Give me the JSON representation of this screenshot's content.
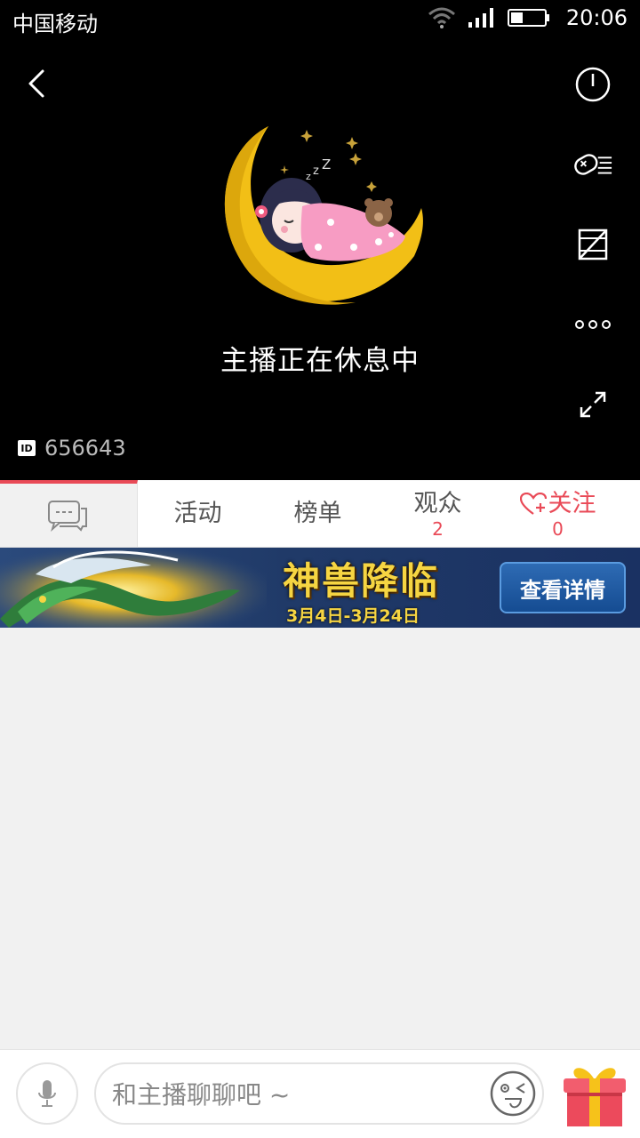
{
  "status_bar": {
    "carrier": "中国移动",
    "time": "20:06",
    "icons": [
      "wifi-icon",
      "signal-icon",
      "battery-icon"
    ]
  },
  "player": {
    "resting_text": "主播正在休息中",
    "room_id": "656643",
    "id_badge": "ID",
    "icons": [
      "back-icon",
      "power-icon",
      "gamepad-icon",
      "danmaku-off-icon",
      "more-icon",
      "fullscreen-icon"
    ]
  },
  "tabs": [
    {
      "label": "",
      "icon": "chat-bubble-icon"
    },
    {
      "label": "活动"
    },
    {
      "label": "榜单"
    },
    {
      "label": "观众",
      "count": "2"
    },
    {
      "label": "关注",
      "count": "0",
      "icon": "heart-plus-icon"
    }
  ],
  "banner": {
    "title": "神兽降临",
    "dates": "3月4日-3月24日",
    "button": "查看详情"
  },
  "bottom_bar": {
    "placeholder": "和主播聊聊吧 ~",
    "icons": [
      "mic-icon",
      "emoji-icon",
      "gift-icon"
    ]
  },
  "colors": {
    "accent": "#e94a57",
    "banner_text": "#f6d542",
    "player_bg": "#000000"
  }
}
